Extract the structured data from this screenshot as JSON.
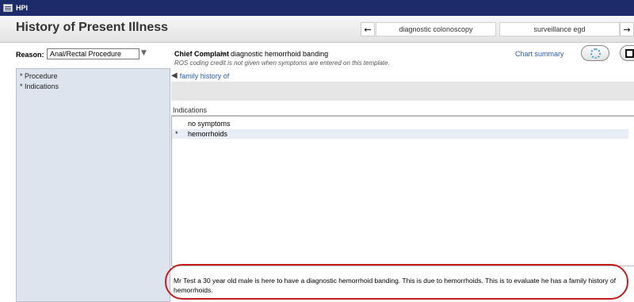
{
  "window": {
    "title": "HPI"
  },
  "header": {
    "page_title": "History of Present Illness",
    "tabs": [
      {
        "label": "diagnostic colonoscopy"
      },
      {
        "label": "surveillance egd"
      }
    ]
  },
  "reason": {
    "label": "Reason:",
    "value": "Anal/Rectal Procedure"
  },
  "chief_complaint": {
    "label": "Chief Complaint",
    "value": "diagnostic hemorrhoid banding",
    "note": "ROS coding credit is not given when symptoms are entered on this template."
  },
  "toolbar": {
    "chart_summary_label": "Chart summary"
  },
  "sidebar": {
    "items": [
      {
        "label": "* Procedure"
      },
      {
        "label": "* Indications"
      }
    ]
  },
  "back_link": {
    "label": "family history of"
  },
  "indications": {
    "title": "Indications",
    "rows": [
      {
        "star": "",
        "label": "no symptoms"
      },
      {
        "star": "*",
        "label": "hemorrhoids"
      }
    ]
  },
  "hpi_text": "Mr Test a 30 year old male is here to have a diagnostic hemorrhoid banding. This is due to hemorrhoids. This is to evaluate he has a family history of hemorrhoids.",
  "colors": {
    "titlebar": "#1d2b6b",
    "link": "#2a5db0",
    "annotation_oval": "#c21d1d",
    "sidebar_bg": "#dde4ee",
    "selected_row": "#e9eef6"
  }
}
